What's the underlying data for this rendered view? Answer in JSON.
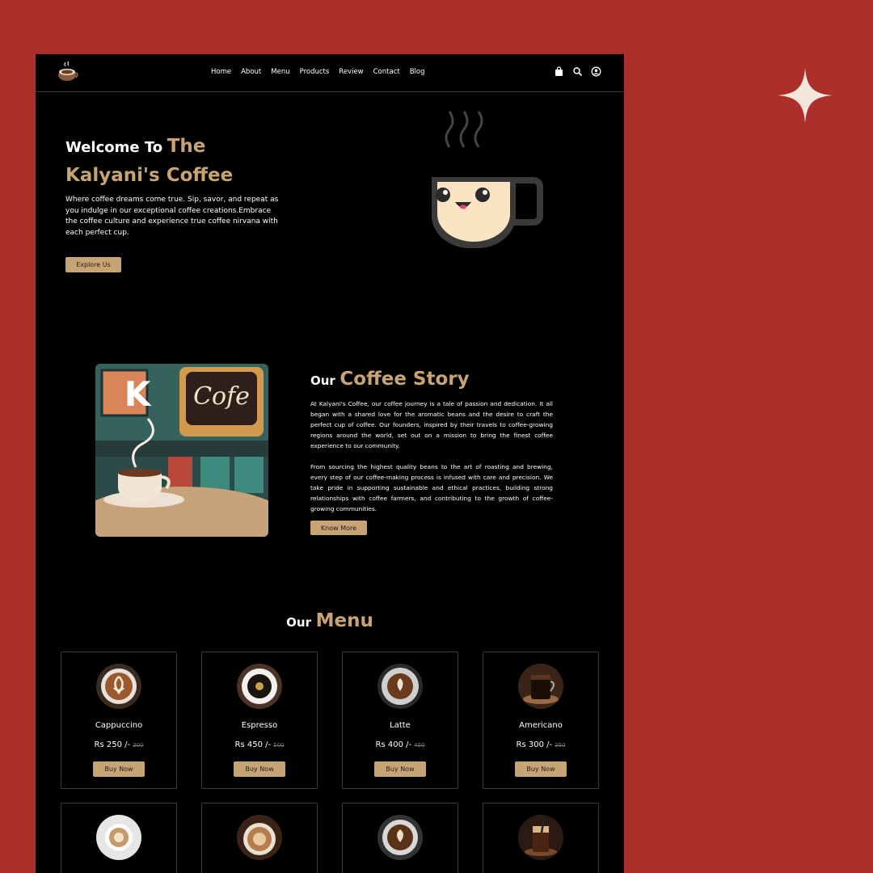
{
  "nav": {
    "links": [
      "Home",
      "About",
      "Menu",
      "Products",
      "Review",
      "Contact",
      "Blog"
    ],
    "icons": [
      "shopping-bag-icon",
      "search-icon",
      "user-icon"
    ]
  },
  "hero": {
    "title_prefix": "Welcome To",
    "title_the": "The",
    "title_brand": "Kalyani's Coffee",
    "description": "Where coffee dreams come true. Sip, savor, and repeat as you indulge in our exceptional coffee creations.Embrace the coffee culture and experience true coffee nirvana with each perfect cup.",
    "button": "Explore Us"
  },
  "story": {
    "title_prefix": "Our",
    "title_highlight": "Coffee Story",
    "paragraph1": "At Kalyani's Coffee, our coffee journey is a tale of passion and dedication. It all began with a shared love for the aromatic beans and the desire to craft the perfect cup of coffee. Our founders, inspired by their travels to coffee-growing regions around the world, set out on a mission to bring the finest coffee experience to our community.",
    "paragraph2": "From sourcing the highest quality beans to the art of roasting and brewing, every step of our coffee-making process is infused with care and precision. We take pride in supporting sustainable and ethical practices, building strong relationships with coffee farmers, and contributing to the growth of coffee-growing communities.",
    "button": "Know More",
    "image_sign": "Cofe",
    "image_letter": "K"
  },
  "menu": {
    "title_prefix": "Our",
    "title_highlight": "Menu",
    "items": [
      {
        "name": "Cappuccino",
        "price": "Rs 250 /-",
        "old_price": "300",
        "button": "Buy Now"
      },
      {
        "name": "Espresso",
        "price": "Rs 450 /-",
        "old_price": "500",
        "button": "Buy Now"
      },
      {
        "name": "Latte",
        "price": "Rs 400 /-",
        "old_price": "450",
        "button": "Buy Now"
      },
      {
        "name": "Americano",
        "price": "Rs 300 /-",
        "old_price": "350",
        "button": "Buy Now"
      }
    ]
  },
  "colors": {
    "background": "#ad2f2c",
    "accent": "#c8a373",
    "page": "#000000"
  }
}
